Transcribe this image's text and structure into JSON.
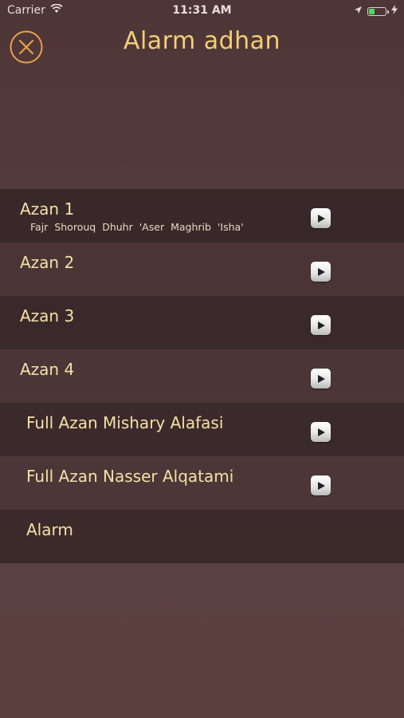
{
  "status_bar": {
    "carrier": "Carrier",
    "time": "11:31 AM",
    "battery_level": 0.35,
    "battery_color": "#4cd964"
  },
  "header": {
    "title": "Alarm adhan",
    "close_icon": "close-icon"
  },
  "list": {
    "items": [
      {
        "label": "Azan 1",
        "prayers": [
          "Fajr",
          "Shorouq",
          "Dhuhr",
          "'Aser",
          "Maghrib",
          "'Isha'"
        ],
        "has_play": true
      },
      {
        "label": "Azan 2",
        "has_play": true
      },
      {
        "label": "Azan 3",
        "has_play": true
      },
      {
        "label": "Azan 4",
        "has_play": true
      },
      {
        "label": "Full Azan Mishary Alafasi",
        "has_play": true
      },
      {
        "label": "Full Azan Nasser Alqatami",
        "has_play": true
      },
      {
        "label": "Alarm",
        "has_play": false
      }
    ]
  },
  "colors": {
    "accent": "#f2cf7a",
    "background": "#553c3c"
  }
}
